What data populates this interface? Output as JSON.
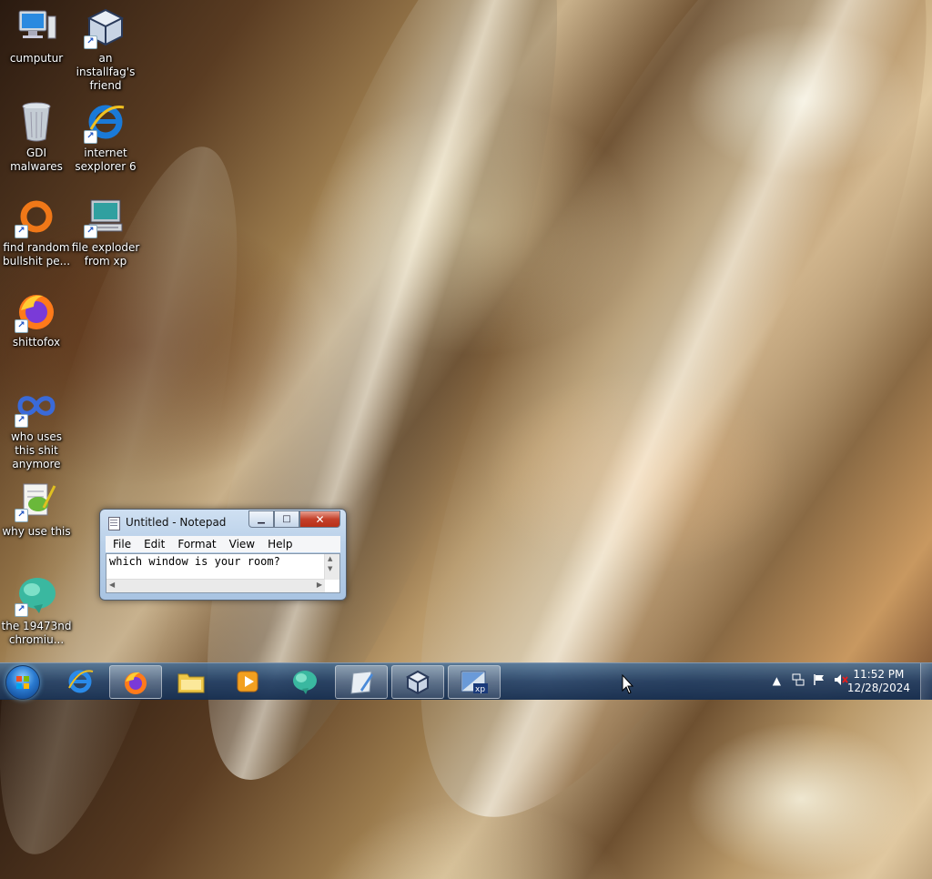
{
  "desktop": {
    "icons": [
      {
        "label": "cumputur",
        "icon": "computer-icon",
        "shortcut": false
      },
      {
        "label": "an installfag's friend",
        "icon": "virtualbox-icon",
        "shortcut": true
      },
      {
        "label": "GDI malwares",
        "icon": "recycle-bin-icon",
        "shortcut": false
      },
      {
        "label": "internet sexplorer 6",
        "icon": "internet-explorer-icon",
        "shortcut": true
      },
      {
        "label": "find random bullshit pe...",
        "icon": "search-ring-icon",
        "shortcut": true
      },
      {
        "label": "file exploder from xp",
        "icon": "xp-explorer-icon",
        "shortcut": true
      },
      {
        "label": "shittofox",
        "icon": "firefox-icon",
        "shortcut": true
      },
      {
        "label": "who uses this shit anymore",
        "icon": "infinity-app-icon",
        "shortcut": true
      },
      {
        "label": "why use this",
        "icon": "notepad-plus-icon",
        "shortcut": true
      },
      {
        "label": "the 19473nd chromiu...",
        "icon": "chromium-fork-icon",
        "shortcut": true
      }
    ]
  },
  "notepad": {
    "title": "Untitled - Notepad",
    "menu": [
      "File",
      "Edit",
      "Format",
      "View",
      "Help"
    ],
    "content": "which window is your room?"
  },
  "taskbar": {
    "pinned": [
      {
        "name": "internet-explorer",
        "icon": "internet-explorer-icon"
      },
      {
        "name": "firefox",
        "icon": "firefox-icon",
        "active": true
      },
      {
        "name": "file-explorer",
        "icon": "folder-icon"
      },
      {
        "name": "media-player",
        "icon": "media-player-icon"
      },
      {
        "name": "chromium-fork",
        "icon": "chromium-fork-icon"
      },
      {
        "name": "notepad",
        "icon": "notepad-icon",
        "active": true
      },
      {
        "name": "virtualbox",
        "icon": "virtualbox-icon",
        "active": true
      },
      {
        "name": "xp-vm",
        "icon": "xp-vm-icon",
        "active": true
      }
    ],
    "tray": {
      "time": "11:52 PM",
      "date": "12/28/2024"
    }
  }
}
